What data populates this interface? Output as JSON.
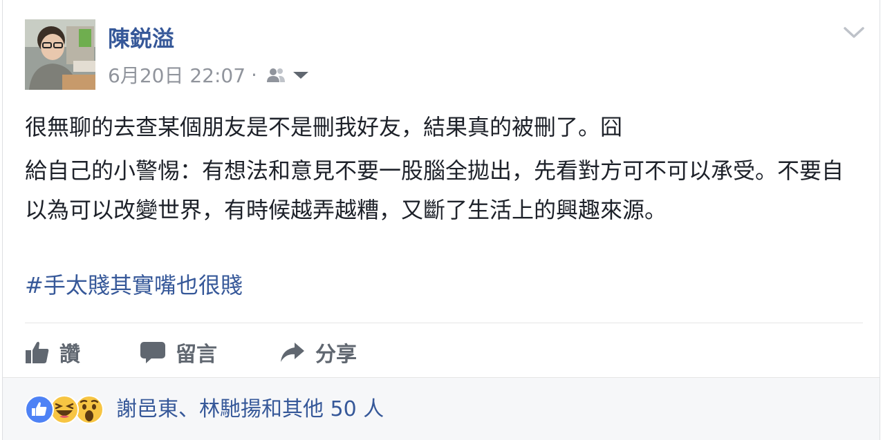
{
  "post": {
    "author": "陳鋭溢",
    "timestamp": "6月20日 22:07",
    "separator": "·",
    "audience_icon": "friends-icon",
    "menu_icon": "chevron-down-icon",
    "paragraphs": [
      "很無聊的去查某個朋友是不是刪我好友，結果真的被刪了。囧",
      "給自己的小警惕：有想法和意見不要一股腦全拋出，先看對方可不可以承受。不要自以為可以改變世界，有時候越弄越糟，又斷了生活上的興趣來源。"
    ],
    "hashtag": "#手太賤其實嘴也很賤"
  },
  "actions": {
    "like_label": "讚",
    "comment_label": "留言",
    "share_label": "分享"
  },
  "reactions": {
    "icons": [
      "like-reaction-icon",
      "haha-reaction-icon",
      "wow-reaction-icon"
    ],
    "summary": "謝邑東、林馳揚和其他 50 人"
  },
  "colors": {
    "link_blue": "#365899",
    "text": "#1d2129",
    "muted": "#90949c",
    "action_gray": "#606770",
    "footer_bg": "#f6f7f9",
    "like_blue": "#4e82f5",
    "emoji_yellow": "#f7c543"
  }
}
